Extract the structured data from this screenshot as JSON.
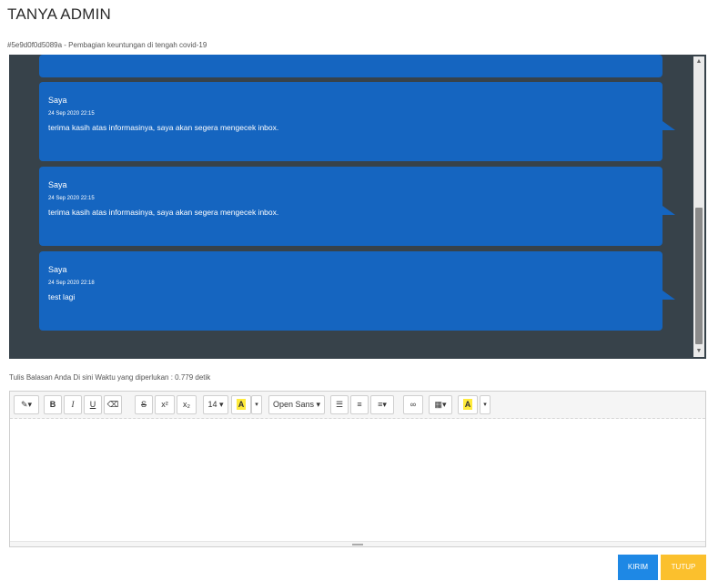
{
  "page": {
    "title": "TANYA ADMIN",
    "ticket_subtitle": "#5e9d0f0d5089a - Pembagian keuntungan di tengah covid-19"
  },
  "messages": [
    {
      "sender": "Saya",
      "time": "24 Sep 2020 22:15",
      "text": "terima kasih atas informasinya, saya akan segera mengecek inbox."
    },
    {
      "sender": "Saya",
      "time": "24 Sep 2020 22:15",
      "text": "terima kasih atas informasinya, saya akan segera mengecek inbox."
    },
    {
      "sender": "Saya",
      "time": "24 Sep 2020 22:18",
      "text": "test lagi"
    }
  ],
  "scrollbar": {
    "up_arrow": "▲",
    "down_arrow": "▼"
  },
  "reply": {
    "label": "Tulis Balasan Anda Di sini Waktu yang diperlukan : 0.779 detik"
  },
  "toolbar": {
    "magic": "✎▾",
    "bold": "B",
    "italic": "I",
    "underline": "U",
    "eraser": "⌫",
    "strike": "S",
    "superscript": "x²",
    "subscript": "x₂",
    "font_size": "14 ▾",
    "color_letter": "A",
    "color_caret": "▾",
    "font_name": "Open Sans ▾",
    "ul": "☰",
    "ol": "≡",
    "align": "≡▾",
    "link": "∞",
    "table": "▦▾",
    "bg_letter": "A",
    "bg_caret": "▾"
  },
  "icons": {
    "magic": "magic-wand-icon",
    "eraser": "eraser-icon",
    "strike": "strikethrough-icon",
    "ul": "unordered-list-icon",
    "ol": "ordered-list-icon",
    "align": "align-icon",
    "link": "link-icon",
    "table": "table-icon"
  },
  "buttons": {
    "send": "KIRIM",
    "close": "TUTUP"
  },
  "colors": {
    "chat_bg": "#37424a",
    "bubble": "#1565c0",
    "send": "#1e88e5",
    "close": "#fbc02d"
  }
}
